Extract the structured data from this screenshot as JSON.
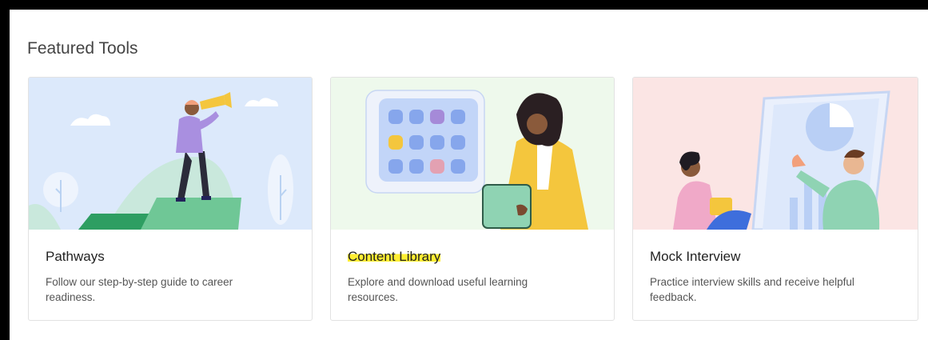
{
  "section": {
    "title": "Featured Tools"
  },
  "cards": [
    {
      "title": "Pathways",
      "description": "Follow our step-by-step guide to career readiness.",
      "illustration_icon": "telescope-person-illustration",
      "bg_color": "#dce9fb"
    },
    {
      "title": "Content Library",
      "description": "Explore and download useful learning resources.",
      "illustration_icon": "library-grid-illustration",
      "bg_color": "#eef9ec",
      "title_highlight_color": "#ffee33"
    },
    {
      "title": "Mock Interview",
      "description": "Practice interview skills and receive helpful feedback.",
      "illustration_icon": "interview-illustration",
      "bg_color": "#fbe5e4"
    }
  ]
}
